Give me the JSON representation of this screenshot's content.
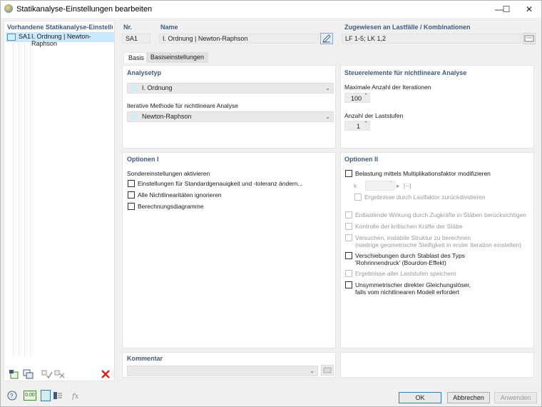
{
  "window": {
    "title": "Statikanalyse-Einstellungen bearbeiten",
    "minimize": "—",
    "maximize": "☐",
    "close": "✕"
  },
  "sidebar": {
    "header": "Vorhandene Statikanalyse-Einstellunge",
    "items": [
      {
        "code": "SA1",
        "label": "I. Ordnung | Newton-Raphson"
      }
    ]
  },
  "header": {
    "nr_label": "Nr.",
    "nr_value": "SA1",
    "name_label": "Name",
    "name_value": "I. Ordnung | Newton-Raphson",
    "assigned_label": "Zugewiesen an Lastfälle / Kombinationen",
    "assigned_value": "LF 1-5; LK 1,2"
  },
  "tabs": [
    "Basis",
    "Basiseinstellungen"
  ],
  "analysis_type": {
    "title": "Analysetyp",
    "value": "I. Ordnung",
    "method_label": "Iterative Methode für nichtlineare Analyse",
    "method_value": "Newton-Raphson"
  },
  "controls": {
    "title": "Steuerelemente für nichtlineare Analyse",
    "max_iter_label": "Maximale Anzahl der Iterationen",
    "max_iter_value": "100",
    "load_steps_label": "Anzahl der Laststufen",
    "load_steps_value": "1"
  },
  "options1": {
    "title": "Optionen I",
    "special_label": "Sondereinstellungen aktivieren",
    "items": [
      "Einstellungen für Standardgenauigkeit und -toleranz ändern...",
      "Alle Nichtlinearitäten ignorieren",
      "Berechnungsdiagramme"
    ]
  },
  "options2": {
    "title": "Optionen II",
    "load_factor": "Belastung mittels Multiplikationsfaktor modifizieren",
    "k_label": "k",
    "k_unit": "[--]",
    "divide": "Ergebnisse durch Lastfaktor zurückdividieren",
    "relieving": "Entlastende Wirkung durch Zugkräfte in Stäben berücksichtigen",
    "critical": "Kontrolle der kritischen Kräfte der Stäbe",
    "unstable_1": "Versuchen, instabile Struktur zu berechnen",
    "unstable_2": "(niedrige geometrische Steifigkeit in erster Iteration einstellen)",
    "bourdon_1": "Verschiebungen durch Stablast des Typs",
    "bourdon_2": "'Rohrinnendruck' (Bourdon-Effekt)",
    "save_steps": "Ergebnisse aller Laststufen speichern",
    "unsym_1": "Unsymmetrischer direkter Gleichungslöser,",
    "unsym_2": "falls vom nichtlinearen Modell erfordert"
  },
  "comment": {
    "title": "Kommentar"
  },
  "buttons": {
    "ok": "OK",
    "cancel": "Abbrechen",
    "apply": "Anwenden"
  },
  "bottom_tools": {
    "units": "0.00"
  },
  "colors": {
    "accent": "#3f5a7f",
    "selection": "#cce8ff",
    "delete": "#e11d1d"
  }
}
